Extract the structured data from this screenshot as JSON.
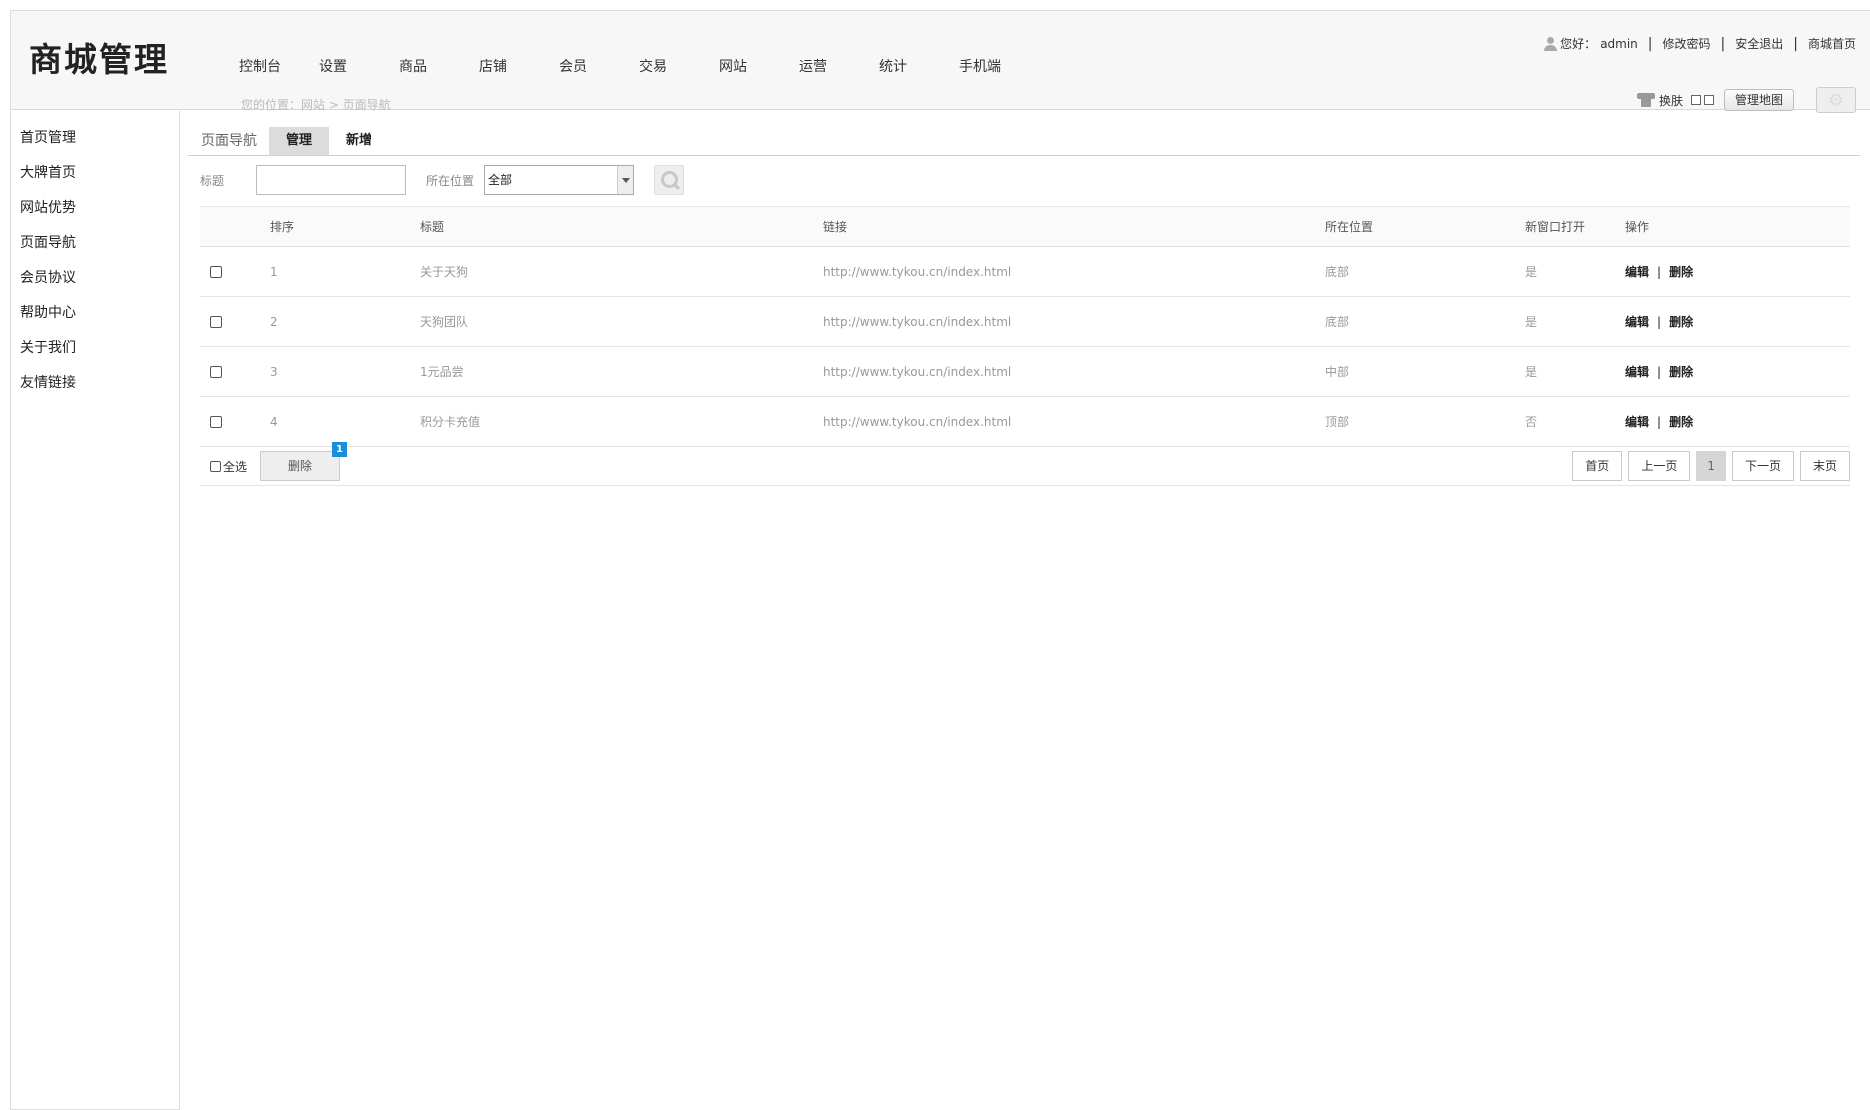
{
  "app": {
    "logo": "商城管理"
  },
  "topnav": [
    "控制台",
    "设置",
    "商品",
    "店铺",
    "会员",
    "交易",
    "网站",
    "运营",
    "统计",
    "手机端"
  ],
  "breadcrumb": "您的位置：网站 > 页面导航",
  "user_bar": {
    "greeting": "您好：",
    "username": "admin",
    "change_password": "修改密码",
    "logout": "安全退出",
    "shop_home": "商城首页"
  },
  "toolbar": {
    "skin_label": "换肤",
    "admin_map": "管理地图"
  },
  "sidebar": [
    "首页管理",
    "大牌首页",
    "网站优势",
    "页面导航",
    "会员协议",
    "帮助中心",
    "关于我们",
    "友情链接"
  ],
  "tabs": {
    "section_title": "页面导航",
    "manage": "管理",
    "add": "新增"
  },
  "filter": {
    "title_label": "标题",
    "title_value": "",
    "position_label": "所在位置",
    "position_selected": "全部"
  },
  "table": {
    "headers": {
      "order": "排序",
      "title": "标题",
      "link": "链接",
      "position": "所在位置",
      "new_window": "新窗口打开",
      "actions": "操作"
    },
    "rows": [
      {
        "order": "1",
        "title": "关于天狗",
        "link": "http://www.tykou.cn/index.html",
        "position": "底部",
        "new_window": "是",
        "edit": "编辑",
        "delete": "删除"
      },
      {
        "order": "2",
        "title": "天狗团队",
        "link": "http://www.tykou.cn/index.html",
        "position": "底部",
        "new_window": "是",
        "edit": "编辑",
        "delete": "删除"
      },
      {
        "order": "3",
        "title": "1元品尝",
        "link": "http://www.tykou.cn/index.html",
        "position": "中部",
        "new_window": "是",
        "edit": "编辑",
        "delete": "删除"
      },
      {
        "order": "4",
        "title": "积分卡充值",
        "link": "http://www.tykou.cn/index.html",
        "position": "顶部",
        "new_window": "否",
        "edit": "编辑",
        "delete": "删除"
      }
    ]
  },
  "footer": {
    "select_all": "全选",
    "delete": "删除",
    "badge": "1",
    "pager": {
      "first": "首页",
      "prev": "上一页",
      "current": "1",
      "next": "下一页",
      "last": "末页"
    }
  },
  "colors": {
    "badge": "#1a8fd6",
    "header_bg": "#f7f7f7",
    "active_tab": "#dcdcdc"
  }
}
